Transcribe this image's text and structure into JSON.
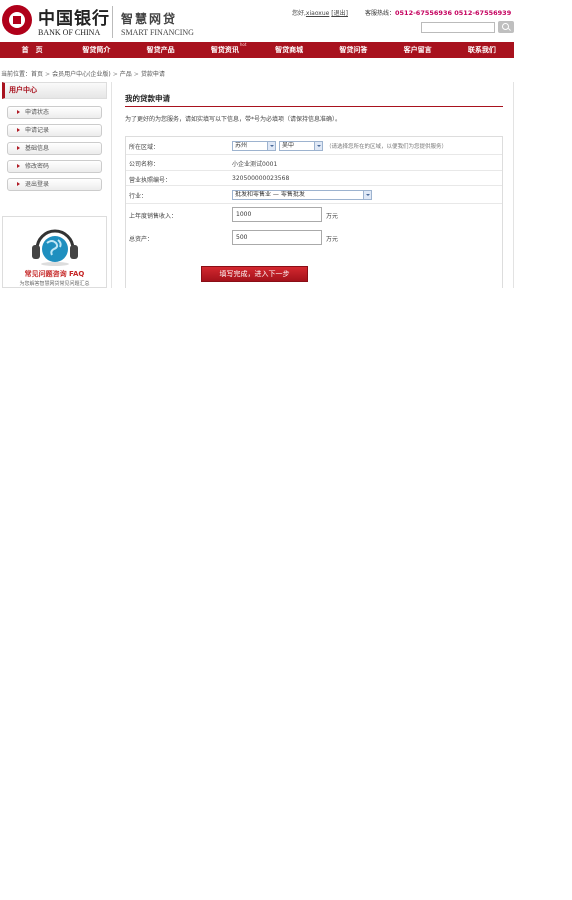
{
  "header": {
    "logo_cn": "中国银行",
    "logo_en": "BANK OF CHINA",
    "site_cn": "智慧网贷",
    "site_en": "SMART FINANCING",
    "welcome": "您好,",
    "username": "xiaoxue",
    "logout": "[退出]",
    "hotline_label": "客服热线：",
    "hotline_numbers": "0512-67556936 0512-67556939"
  },
  "nav": {
    "items": [
      {
        "label": "首　页"
      },
      {
        "label": "智贷简介"
      },
      {
        "label": "智贷产品"
      },
      {
        "label": "智贷资讯",
        "badge": "hot"
      },
      {
        "label": "智贷商城"
      },
      {
        "label": "智贷问答"
      },
      {
        "label": "客户留言"
      },
      {
        "label": "联系我们"
      }
    ]
  },
  "breadcrumb": {
    "label": "当前位置：",
    "items": [
      "首页",
      "会员用户中心(企业版)",
      "产品",
      "贷款申请"
    ]
  },
  "sidebar": {
    "title": "用户中心",
    "items": [
      "申请状态",
      "申请记录",
      "基础信息",
      "修改密码",
      "退出登录"
    ]
  },
  "faq": {
    "title": "常见问题咨询 FAQ",
    "desc": "为您解答智慧网贷常见问题汇总"
  },
  "main": {
    "title": "我的贷款申请",
    "intro": "为了更好的为您服务，请如实填写以下信息，带*号为必填项（请保持信息准确）。",
    "region": {
      "label": "所在区域：",
      "province": "苏州",
      "city": "吴中",
      "hint": "（请选择您所在的区域，以便我们为您提供服务）"
    },
    "company": {
      "label": "公司名称：",
      "value": "小企业测试0001"
    },
    "license": {
      "label": "营业执照编号：",
      "value": "320500000023568"
    },
    "industry": {
      "label": "行业：",
      "value": "批发和零售业 — 零售批发"
    },
    "income": {
      "label": "上年度销售收入：",
      "value": "1000",
      "unit": "万元"
    },
    "assets": {
      "label": "总资产：",
      "value": "500",
      "unit": "万元"
    },
    "submit_label": "填写完成，进入下一步"
  }
}
